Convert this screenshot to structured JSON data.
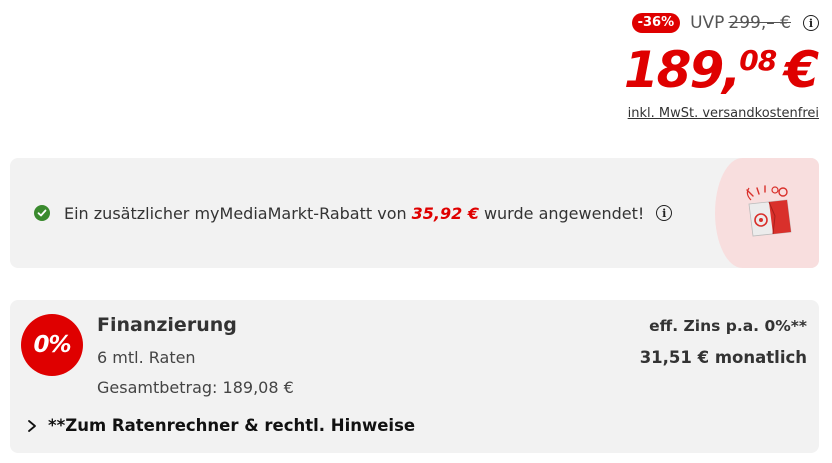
{
  "price": {
    "discount_badge": "-36%",
    "uvp_label": "UVP",
    "uvp_old_price": "299,– €",
    "current_integer": "189,",
    "current_cents": "08",
    "currency": "€",
    "tax_shipping_note": "inkl. MwSt. versandkostenfrei",
    "info_icon": "info-icon"
  },
  "rabatt": {
    "text_before": "Ein zusätzlicher myMediaMarkt-Rabatt von",
    "amount": "35,92 €",
    "text_after": "wurde angewendet!",
    "status_icon": "check-circle-icon",
    "info_icon": "info-icon",
    "illustration": "gift-bag-icon"
  },
  "finance": {
    "badge": "0%",
    "title": "Finanzierung",
    "rates": "6 mtl. Raten",
    "total": "Gesamtbetrag: 189,08 €",
    "rate_info": "eff. Zins p.a. 0%**",
    "monthly": "31,51 € monatlich",
    "link_label": "**Zum Ratenrechner & rechtl. Hinweise",
    "link_icon": "chevron-right-icon"
  },
  "colors": {
    "accent": "#df0000",
    "success": "#3a8a2e",
    "panel_bg": "#f2f2f2",
    "promo_bg": "#f8dede"
  }
}
